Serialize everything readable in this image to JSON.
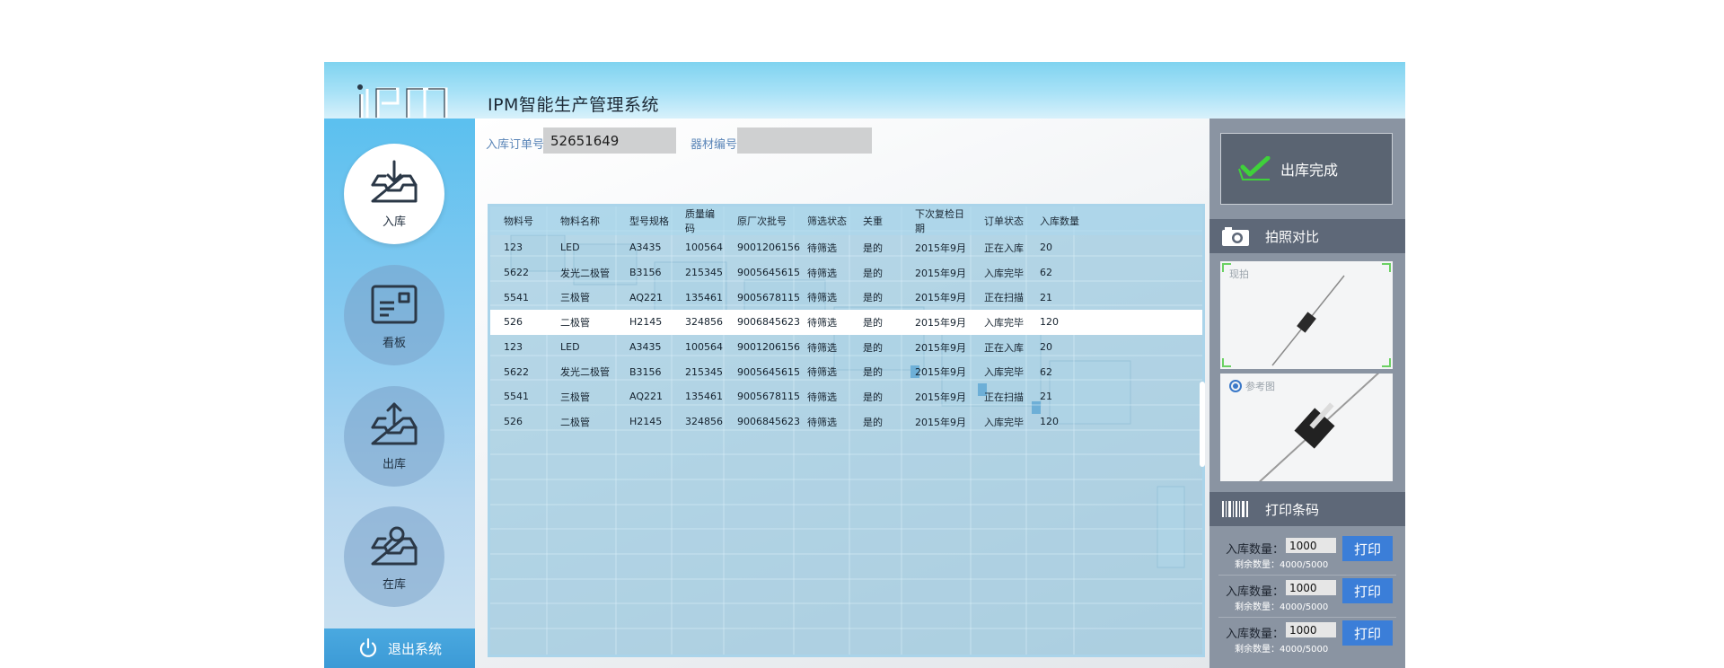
{
  "header": {
    "logo_text": "IPM",
    "title": "IPM智能生产管理系统"
  },
  "sidebar": {
    "items": [
      {
        "label": "入库",
        "icon": "inbox-in-icon",
        "active": true
      },
      {
        "label": "看板",
        "icon": "board-icon",
        "active": false
      },
      {
        "label": "出库",
        "icon": "inbox-out-icon",
        "active": false
      },
      {
        "label": "在库",
        "icon": "inbox-search-icon",
        "active": false
      }
    ],
    "logout_label": "退出系统"
  },
  "form": {
    "order_label": "入库订单号",
    "order_value": "52651649",
    "device_label": "器材编号",
    "device_value": ""
  },
  "table": {
    "columns": [
      "物料号",
      "物料名称",
      "型号规格",
      "质量编码",
      "原厂次批号",
      "筛选状态",
      "关重",
      "下次复检日期",
      "订单状态",
      "入库数量"
    ],
    "rows": [
      [
        "123",
        "LED",
        "A3435",
        "100564",
        "9001206156",
        "待筛选",
        "是的",
        "2015年9月",
        "正在入库",
        "20"
      ],
      [
        "5622",
        "发光二极管",
        "B3156",
        "215345",
        "9005645615",
        "待筛选",
        "是的",
        "2015年9月",
        "入库完毕",
        "62"
      ],
      [
        "5541",
        "三极管",
        "AQ221",
        "135461",
        "9005678115",
        "待筛选",
        "是的",
        "2015年9月",
        "正在扫描",
        "21"
      ],
      [
        "526",
        "二极管",
        "H2145",
        "324856",
        "9006845623",
        "待筛选",
        "是的",
        "2015年9月",
        "入库完毕",
        "120"
      ],
      [
        "123",
        "LED",
        "A3435",
        "100564",
        "9001206156",
        "待筛选",
        "是的",
        "2015年9月",
        "正在入库",
        "20"
      ],
      [
        "5622",
        "发光二极管",
        "B3156",
        "215345",
        "9005645615",
        "待筛选",
        "是的",
        "2015年9月",
        "入库完毕",
        "62"
      ],
      [
        "5541",
        "三极管",
        "AQ221",
        "135461",
        "9005678115",
        "待筛选",
        "是的",
        "2015年9月",
        "正在扫描",
        "21"
      ],
      [
        "526",
        "二极管",
        "H2145",
        "324856",
        "9006845623",
        "待筛选",
        "是的",
        "2015年9月",
        "入库完毕",
        "120"
      ]
    ],
    "selected_row": 3
  },
  "right": {
    "done_label": "出库完成",
    "photo_section": "拍照对比",
    "photo_live_label": "现拍",
    "photo_ref_label": "参考图",
    "barcode_section": "打印条码",
    "print_rows": [
      {
        "qty_label": "入库数量：",
        "qty_value": "1000",
        "remain": "剩余数量：4000/5000",
        "print_label": "打印"
      },
      {
        "qty_label": "入库数量：",
        "qty_value": "1000",
        "remain": "剩余数量：4000/5000",
        "print_label": "打印"
      },
      {
        "qty_label": "入库数量：",
        "qty_value": "1000",
        "remain": "剩余数量：4000/5000",
        "print_label": "打印"
      }
    ]
  },
  "colors": {
    "header": "#a9e2f7",
    "sidebar": "#5bc0ef",
    "accent_blue": "#3b7ed8",
    "check_green": "#3fd13a",
    "right_panel": "#8a94a2"
  }
}
